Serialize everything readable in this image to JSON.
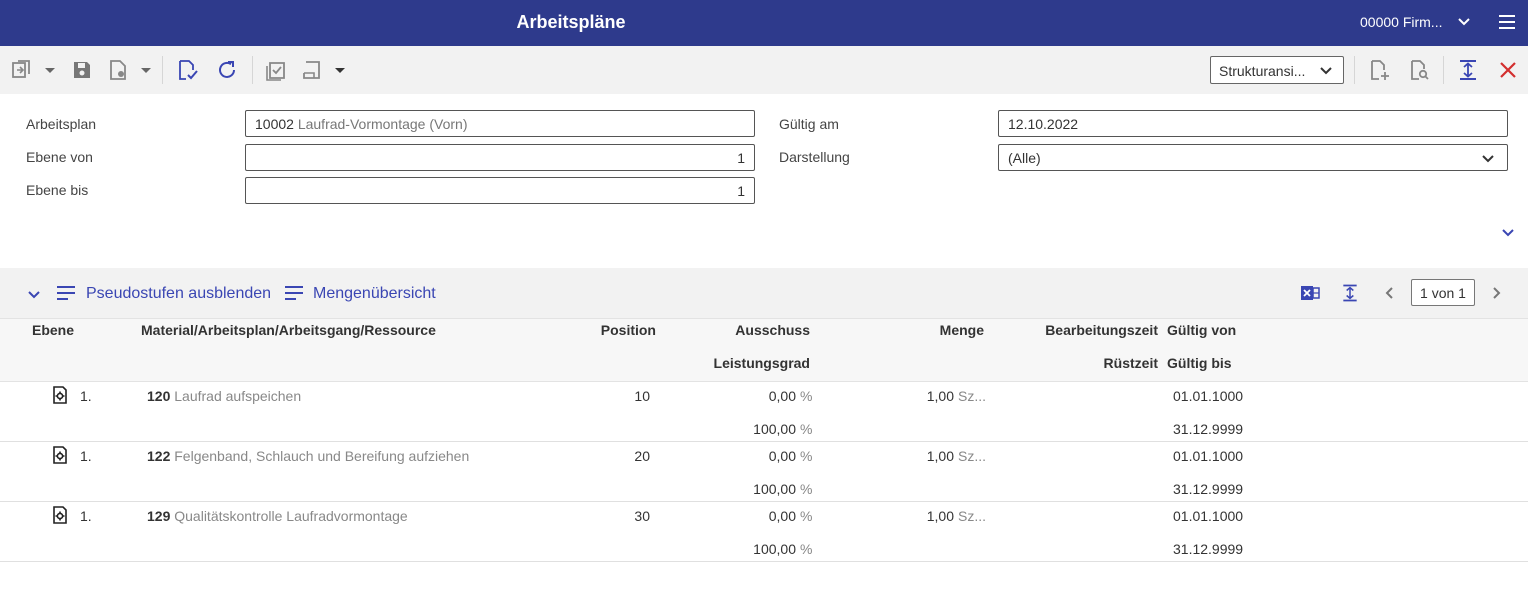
{
  "header": {
    "title": "Arbeitspläne",
    "company": "00000  Firm..."
  },
  "toolbar": {
    "view_select": "Strukturansi..."
  },
  "form": {
    "arbeitsplan_label": "Arbeitsplan",
    "arbeitsplan_id": "10002",
    "arbeitsplan_name": "Laufrad-Vormontage (Vorn)",
    "ebene_von_label": "Ebene von",
    "ebene_von_value": "1",
    "ebene_bis_label": "Ebene bis",
    "ebene_bis_value": "1",
    "gueltig_am_label": "Gültig am",
    "gueltig_am_value": "12.10.2022",
    "darstellung_label": "Darstellung",
    "darstellung_value": "(Alle)"
  },
  "section": {
    "pseudo_link": "Pseudostufen ausblenden",
    "mengen_link": "Mengenübersicht",
    "pager": "1 von 1"
  },
  "table": {
    "headers": {
      "ebene": "Ebene",
      "material": "Material/Arbeitsplan/Arbeitsgang/Ressource",
      "position": "Position",
      "ausschuss": "Ausschuss",
      "leistungsgrad": "Leistungsgrad",
      "menge": "Menge",
      "bearbeitungszeit": "Bearbeitungszeit",
      "ruestzeit": "Rüstzeit",
      "gueltig_von": "Gültig von",
      "gueltig_bis": "Gültig bis"
    },
    "rows": [
      {
        "level": "1.",
        "code": "120",
        "name": "Laufrad aufspeichen",
        "position": "10",
        "ausschuss": "0,00",
        "leistungsgrad": "100,00",
        "pct": "%",
        "menge": "1,00",
        "unit": "Sz...",
        "von": "01.01.1000",
        "bis": "31.12.9999"
      },
      {
        "level": "1.",
        "code": "122",
        "name": "Felgenband, Schlauch und Bereifung aufziehen",
        "position": "20",
        "ausschuss": "0,00",
        "leistungsgrad": "100,00",
        "pct": "%",
        "menge": "1,00",
        "unit": "Sz...",
        "von": "01.01.1000",
        "bis": "31.12.9999"
      },
      {
        "level": "1.",
        "code": "129",
        "name": "Qualitätskontrolle Laufradvormontage",
        "position": "30",
        "ausschuss": "0,00",
        "leistungsgrad": "100,00",
        "pct": "%",
        "menge": "1,00",
        "unit": "Sz...",
        "von": "01.01.1000",
        "bis": "31.12.9999"
      }
    ]
  },
  "colors": {
    "header_bg": "#2e3a8c",
    "accent": "#3a46b3",
    "close": "#d32f2f"
  }
}
